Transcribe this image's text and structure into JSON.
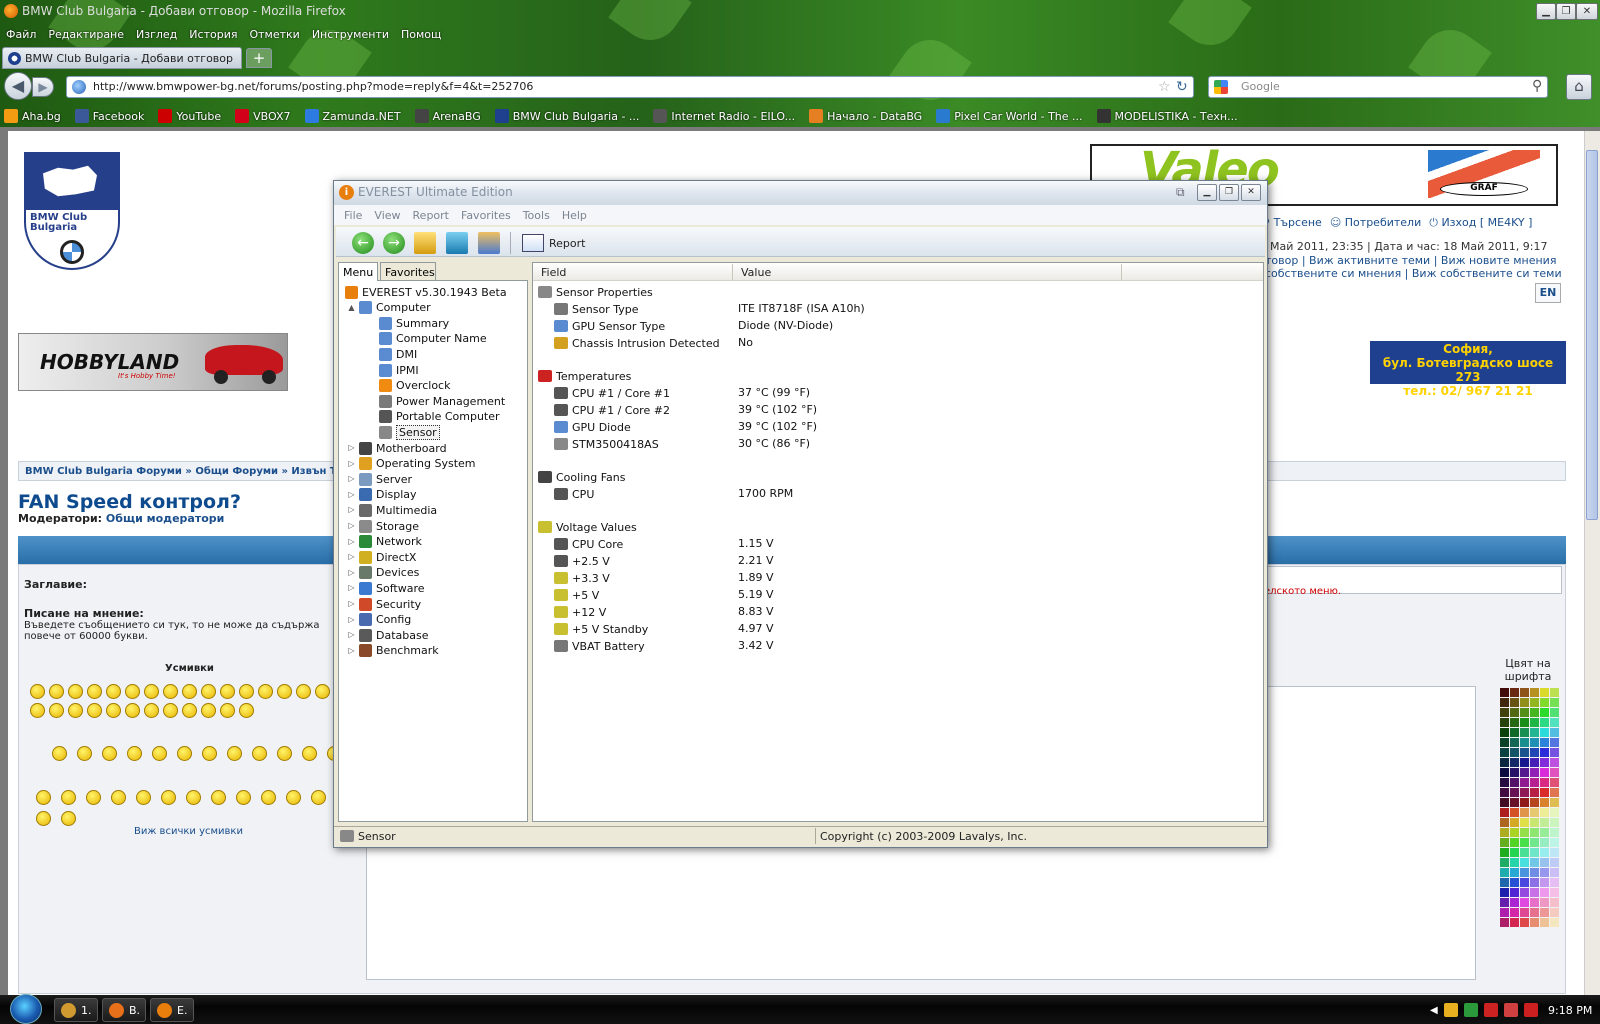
{
  "browser": {
    "window_title": "BMW Club Bulgaria - Добави отговор - Mozilla Firefox",
    "menu": [
      "Файл",
      "Редактиране",
      "Изглед",
      "История",
      "Отметки",
      "Инструменти",
      "Помощ"
    ],
    "tab_label": "BMW Club Bulgaria - Добави отговор",
    "new_tab": "+",
    "url": "http://www.bmwpower-bg.net/forums/posting.php?mode=reply&f=4&t=252706",
    "search_placeholder": "Google",
    "bookmarks": [
      {
        "label": "Aha.bg",
        "color": "#f39c12"
      },
      {
        "label": "Facebook",
        "color": "#3b5998"
      },
      {
        "label": "YouTube",
        "color": "#cc0000"
      },
      {
        "label": "VBOX7",
        "color": "#d3001a"
      },
      {
        "label": "Zamunda.NET",
        "color": "#2d7be0"
      },
      {
        "label": "ArenaBG",
        "color": "#444444"
      },
      {
        "label": "BMW Club Bulgaria - ...",
        "color": "#1f3f8f"
      },
      {
        "label": "Internet Radio - EILO...",
        "color": "#555555"
      },
      {
        "label": "Начало - DataBG",
        "color": "#e67e22"
      },
      {
        "label": "Pixel Car World - The ...",
        "color": "#2a7ad0"
      },
      {
        "label": "MODELISTIKA - Техн...",
        "color": "#333333"
      }
    ]
  },
  "forum": {
    "logo_text": "BMW Club Bulgaria",
    "topnav": [
      "Търсене",
      "Потребители",
      "Изход [ ME4KY ]"
    ],
    "date_line": "Май 2011, 23:35 | Дата и час: 18 Май 2011, 9:17",
    "links_line1": "товор | Виж активните теми | Виж новите мнения",
    "links_line2": "собствените си мнения | Виж собствените си теми",
    "lang": "EN",
    "hobby_brand": "HOBBYLAND",
    "hobby_slogan": "It's Hobby Time!",
    "valeo_brand": "Valeo",
    "graf_brand": "GRAF",
    "sofia_banner": [
      "София,",
      "бул. Ботевградско шосе 273",
      "тел.: 02/ 967 21 21"
    ],
    "breadcrumb": "BMW Club Bulgaria Форуми » Общи Форуми » Извън Т",
    "topic_title": "FAN Speed контрол?",
    "moderators_label": "Модератори:",
    "moderators_link": "Общи модератори",
    "subject_label": "Заглавие:",
    "red_hint": "елското меню.",
    "message_label": "Писане на мнение:",
    "message_hint": "Въведете съобщението си тук, то не може да съдържа повече от 60000 букви.",
    "smilies_label": "Усмивки",
    "view_all_smilies": "Виж всички усмивки",
    "font_color_label": "Цвят на шрифта"
  },
  "everest": {
    "title": "EVEREST Ultimate Edition",
    "menu": [
      "File",
      "View",
      "Report",
      "Favorites",
      "Tools",
      "Help"
    ],
    "toolbar_report": "Report",
    "tabs": [
      "Menu",
      "Favorites"
    ],
    "tree": [
      {
        "label": "EVEREST v5.30.1943 Beta",
        "level": 0,
        "color": "#e87e0c"
      },
      {
        "label": "Computer",
        "level": 1,
        "color": "#5a8ad0",
        "exp": "▲"
      },
      {
        "label": "Summary",
        "level": 2,
        "color": "#5a8ad0"
      },
      {
        "label": "Computer Name",
        "level": 2,
        "color": "#5a8ad0"
      },
      {
        "label": "DMI",
        "level": 2,
        "color": "#5a8ad0"
      },
      {
        "label": "IPMI",
        "level": 2,
        "color": "#5a8ad0"
      },
      {
        "label": "Overclock",
        "level": 2,
        "color": "#f08a10"
      },
      {
        "label": "Power Management",
        "level": 2,
        "color": "#7a7a7a"
      },
      {
        "label": "Portable Computer",
        "level": 2,
        "color": "#555555"
      },
      {
        "label": "Sensor",
        "level": 2,
        "color": "#888888",
        "selected": true
      },
      {
        "label": "Motherboard",
        "level": 1,
        "color": "#444444",
        "exp": "▷"
      },
      {
        "label": "Operating System",
        "level": 1,
        "color": "#e0a020",
        "exp": "▷"
      },
      {
        "label": "Server",
        "level": 1,
        "color": "#7a9ac0",
        "exp": "▷"
      },
      {
        "label": "Display",
        "level": 1,
        "color": "#3a6ab0",
        "exp": "▷"
      },
      {
        "label": "Multimedia",
        "level": 1,
        "color": "#6a6a6a",
        "exp": "▷"
      },
      {
        "label": "Storage",
        "level": 1,
        "color": "#8a8a8a",
        "exp": "▷"
      },
      {
        "label": "Network",
        "level": 1,
        "color": "#2a8a3a",
        "exp": "▷"
      },
      {
        "label": "DirectX",
        "level": 1,
        "color": "#d0b020",
        "exp": "▷"
      },
      {
        "label": "Devices",
        "level": 1,
        "color": "#6a7a6a",
        "exp": "▷"
      },
      {
        "label": "Software",
        "level": 1,
        "color": "#3a7ad0",
        "exp": "▷"
      },
      {
        "label": "Security",
        "level": 1,
        "color": "#d04a2a",
        "exp": "▷"
      },
      {
        "label": "Config",
        "level": 1,
        "color": "#4a6ab0",
        "exp": "▷"
      },
      {
        "label": "Database",
        "level": 1,
        "color": "#5a5a5a",
        "exp": "▷"
      },
      {
        "label": "Benchmark",
        "level": 1,
        "color": "#8a4a2a",
        "exp": "▷"
      }
    ],
    "columns": [
      "Field",
      "Value"
    ],
    "sections": [
      {
        "title": "Sensor Properties",
        "icon_color": "#888888",
        "rows": [
          {
            "field": "Sensor Type",
            "value": "ITE IT8718F  (ISA A10h)",
            "color": "#777777"
          },
          {
            "field": "GPU Sensor Type",
            "value": "Diode  (NV-Diode)",
            "color": "#5a8ad0"
          },
          {
            "field": "Chassis Intrusion Detected",
            "value": "No",
            "color": "#d4a020"
          }
        ]
      },
      {
        "title": "Temperatures",
        "icon_color": "#cc2222",
        "rows": [
          {
            "field": "CPU #1 / Core #1",
            "value": "37 °C  (99 °F)",
            "color": "#555555"
          },
          {
            "field": "CPU #1 / Core #2",
            "value": "39 °C  (102 °F)",
            "color": "#555555"
          },
          {
            "field": "GPU Diode",
            "value": "39 °C  (102 °F)",
            "color": "#5a8ad0"
          },
          {
            "field": "STM3500418AS",
            "value": "30 °C  (86 °F)",
            "color": "#888888"
          }
        ]
      },
      {
        "title": "Cooling Fans",
        "icon_color": "#444444",
        "rows": [
          {
            "field": "CPU",
            "value": "1700 RPM",
            "color": "#555555"
          }
        ]
      },
      {
        "title": "Voltage Values",
        "icon_color": "#c8c030",
        "rows": [
          {
            "field": "CPU Core",
            "value": "1.15 V",
            "color": "#555555"
          },
          {
            "field": "+2.5 V",
            "value": "2.21 V",
            "color": "#555555"
          },
          {
            "field": "+3.3 V",
            "value": "1.89 V",
            "color": "#c8c030"
          },
          {
            "field": "+5 V",
            "value": "5.19 V",
            "color": "#c8c030"
          },
          {
            "field": "+12 V",
            "value": "8.83 V",
            "color": "#c8c030"
          },
          {
            "field": "+5 V Standby",
            "value": "4.97 V",
            "color": "#c8c030"
          },
          {
            "field": "VBAT Battery",
            "value": "3.42 V",
            "color": "#777777"
          }
        ]
      }
    ],
    "status_left": "Sensor",
    "status_right": "Copyright (c) 2003-2009 Lavalys, Inc."
  },
  "taskbar": {
    "items": [
      {
        "label": "1.",
        "color": "#d09a30"
      },
      {
        "label": "B.",
        "color": "#e8701a"
      },
      {
        "label": "E.",
        "color": "#e87e0c"
      }
    ],
    "clock": "9:18 PM",
    "tray_colors": [
      "#e8b020",
      "#2a9a3a",
      "#cc2222",
      "#d04040",
      "#cc2020"
    ]
  }
}
